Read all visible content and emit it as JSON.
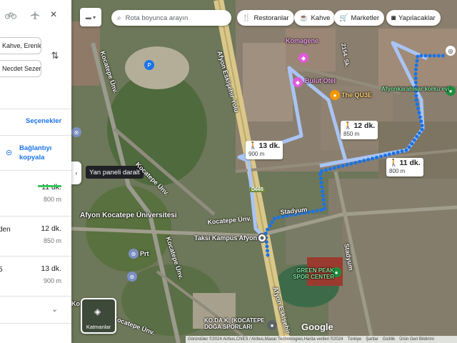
{
  "panel": {
    "modes": [
      "bike",
      "flight"
    ],
    "close_icon": "×",
    "origin": "Kahve, Erenler",
    "destination": "Necdet Sezer",
    "options_label": "Seçenekler",
    "copy_link_label": "Bağlantıyı kopyala",
    "routes": [
      {
        "prefix": "",
        "duration": "11 dk.",
        "distance": "800 m",
        "selected": true
      },
      {
        "prefix": "den",
        "duration": "12 dk.",
        "distance": "850 m",
        "selected": false
      },
      {
        "prefix": "5",
        "duration": "13 dk.",
        "distance": "900 m",
        "selected": false
      }
    ]
  },
  "map": {
    "search_placeholder": "Rota boyunca arayın",
    "chips": [
      {
        "label": "Restoranlar",
        "icon": "fork-knife-icon"
      },
      {
        "label": "Kahve",
        "icon": "coffee-icon"
      },
      {
        "label": "Marketler",
        "icon": "cart-icon"
      },
      {
        "label": "Yapılacaklar",
        "icon": "camera-icon"
      }
    ],
    "collapse_tooltip": "Yan paneli daralt",
    "route_labels": [
      {
        "time": "13 dk.",
        "dist": "900 m"
      },
      {
        "time": "12 dk.",
        "dist": "850 m"
      },
      {
        "time": "11 dk.",
        "dist": "800 m"
      }
    ],
    "street_labels": {
      "afyon_eskisehir_yolu": "Afyon Eskişehir Yolu",
      "afyon_eskisehir_lower": "Afyon Eskişehir",
      "kocatepe_unv_1": "Kocatepe Ünv.",
      "kocatepe_unv_2": "Kocatepe Ünv.",
      "kocatepe_unv_3": "Kocatepe Ünv.",
      "kocatepe_unv_4": "Kocatepe Ünv.",
      "stadyum": "Stadyum",
      "stadyum_2": "Stadyum",
      "d665": "D665",
      "street_2154": "2154. Sk."
    },
    "place_labels": {
      "komagene": "Komagene",
      "bulut_otel": "Bulut Otel",
      "the_qube": "The QU3E",
      "afyonkarahisar": "Afyonkarahisar korku evi",
      "afyon_kocatepe": "Afyon Kocatepe Üniversitesi",
      "taksi": "Taksi Kampüs Afyon",
      "green_peak": "GREEN PEAK SPOR CENTER",
      "koda": "KO.DA.K. (KOCATEPE DOĞA SPORLARI",
      "prt": "Prt",
      "ko": "Ko"
    },
    "layers_label": "Katmanlar",
    "google_logo": "Google",
    "attribution": [
      "Görüntüler ©2024 Airbus,CNES / Airbus,Maxar Technologies,Harita verileri ©2024",
      "Türkiye",
      "Şartlar",
      "Gizlilik",
      "Ürün Geri Bildirimi"
    ]
  }
}
